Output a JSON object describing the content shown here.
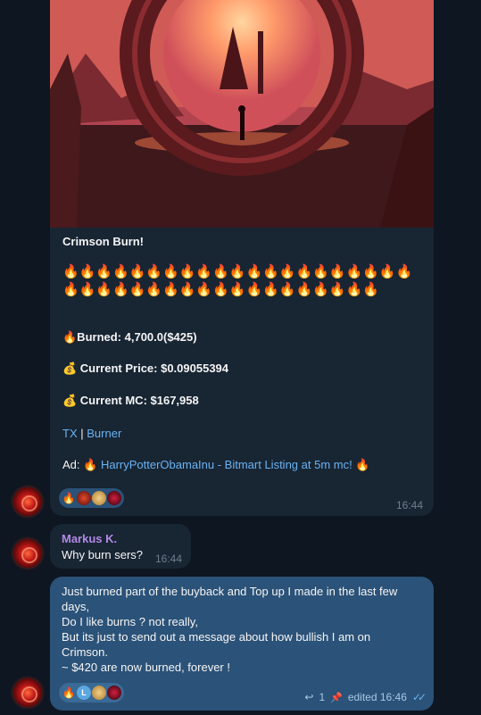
{
  "msg1": {
    "title": "Crimson Burn!",
    "fires": "🔥🔥🔥🔥🔥🔥🔥🔥🔥🔥🔥🔥🔥🔥🔥🔥🔥🔥🔥🔥🔥🔥🔥🔥🔥🔥🔥🔥🔥🔥🔥🔥🔥🔥🔥🔥🔥🔥🔥🔥",
    "burned": "🔥Burned: 4,700.0($425)",
    "price": "💰 Current Price: $0.09055394",
    "mc": "💰 Current MC: $167,958",
    "tx_link": "TX",
    "separator": "|",
    "burner_link": "Burner",
    "ad_label": "Ad:",
    "ad_fire_left": "🔥",
    "ad_link": "HarryPotterObamaInu - Bitmart Listing at 5m mc!",
    "ad_fire_right": "🔥",
    "time": "16:44",
    "reaction_emoji": "🔥"
  },
  "msg2": {
    "sender": "Markus K.",
    "text": "Why burn sers?",
    "time": "16:44"
  },
  "msg3": {
    "lines": [
      "Just burned part of the buyback and Top up I made in the last few",
      "days,",
      "Do I like burns ? not really,",
      "But its just to send out a message about how bullish I am on",
      "Crimson.",
      "~ $420 are now burned, forever !"
    ],
    "reaction_emoji": "🔥",
    "reaction_letter": "L",
    "reply_count": "1",
    "status": "edited 16:46",
    "reply_icon_glyph": "↩",
    "pin_icon_glyph": "📌",
    "check_glyph": "✓✓"
  }
}
